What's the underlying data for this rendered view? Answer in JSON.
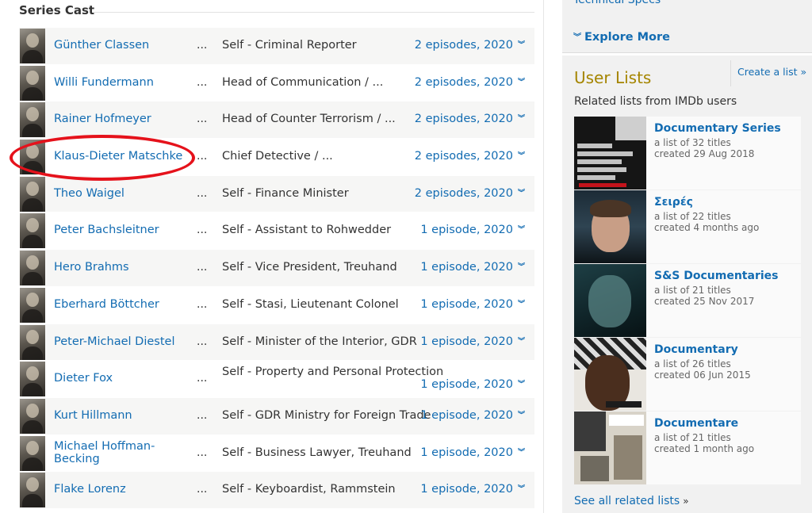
{
  "cast_section": {
    "title": "Series Cast",
    "ellipsis": "...",
    "rows": [
      {
        "name": "Günther Classen",
        "character": "Self - Criminal Reporter",
        "episodes": "2 episodes, 2020"
      },
      {
        "name": "Willi Fundermann",
        "character": "Head of Communication / ...",
        "episodes": "2 episodes, 2020"
      },
      {
        "name": "Rainer Hofmeyer",
        "character": "Head of Counter Terrorism / ...",
        "episodes": "2 episodes, 2020"
      },
      {
        "name": "Klaus-Dieter Matschke",
        "character": "Chief Detective / ...",
        "episodes": "2 episodes, 2020"
      },
      {
        "name": "Theo Waigel",
        "character": "Self - Finance Minister",
        "episodes": "2 episodes, 2020"
      },
      {
        "name": "Peter Bachsleitner",
        "character": "Self - Assistant to Rohwedder",
        "episodes": "1 episode, 2020"
      },
      {
        "name": "Hero Brahms",
        "character": "Self - Vice President, Treuhand",
        "episodes": "1 episode, 2020"
      },
      {
        "name": "Eberhard Böttcher",
        "character": "Self - Stasi, Lieutenant Colonel",
        "episodes": "1 episode, 2020"
      },
      {
        "name": "Peter-Michael Diestel",
        "character": "Self - Minister of the Interior, GDR",
        "episodes": "1 episode, 2020"
      },
      {
        "name": "Dieter Fox",
        "character": "Self - Property and Personal Protection",
        "episodes": "1 episode, 2020"
      },
      {
        "name": "Kurt Hillmann",
        "character": "Self - GDR Ministry for Foreign Trade",
        "episodes": "1 episode, 2020"
      },
      {
        "name": "Michael Hoffman-Becking",
        "character": "Self - Business Lawyer, Treuhand",
        "episodes": "1 episode, 2020"
      },
      {
        "name": "Flake Lorenz",
        "character": "Self - Keyboardist, Rammstein",
        "episodes": "1 episode, 2020"
      }
    ]
  },
  "sidebar_top": {
    "tech_specs": "Technical Specs",
    "explore_more": "Explore More"
  },
  "user_lists": {
    "title": "User Lists",
    "create_list": "Create a list »",
    "subtitle": "Related lists from IMDb users",
    "lists": [
      {
        "title": "Documentary Series",
        "count": "a list of 32 titles",
        "created": "created 29 Aug 2018"
      },
      {
        "title": "Σειρές",
        "count": "a list of 22 titles",
        "created": "created 4 months ago"
      },
      {
        "title": "S&S Documentaries",
        "count": "a list of 21 titles",
        "created": "created 25 Nov 2017"
      },
      {
        "title": "Documentary",
        "count": "a list of 26 titles",
        "created": "created 06 Jun 2015"
      },
      {
        "title": "Documentare",
        "count": "a list of 21 titles",
        "created": "created 1 month ago"
      }
    ],
    "see_all": "See all related lists",
    "see_all_arrow": "»"
  },
  "colors": {
    "link": "#136cb2",
    "user_lists_title": "#a58500",
    "highlight_oval": "#e5121b"
  }
}
